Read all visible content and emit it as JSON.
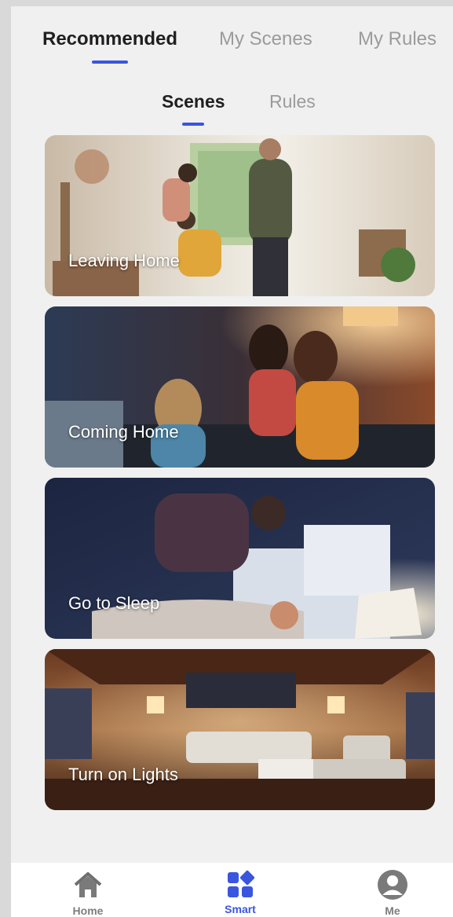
{
  "top_tabs": [
    {
      "label": "Recommended",
      "active": true
    },
    {
      "label": "My Scenes",
      "active": false
    },
    {
      "label": "My Rules",
      "active": false
    }
  ],
  "sub_tabs": [
    {
      "label": "Scenes",
      "active": true
    },
    {
      "label": "Rules",
      "active": false
    }
  ],
  "scenes": [
    {
      "label": "Leaving Home"
    },
    {
      "label": "Coming Home"
    },
    {
      "label": "Go to Sleep"
    },
    {
      "label": "Turn on Lights"
    }
  ],
  "bottom_nav": [
    {
      "label": "Home",
      "icon": "home-icon",
      "active": false
    },
    {
      "label": "Smart",
      "icon": "smart-icon",
      "active": true
    },
    {
      "label": "Me",
      "icon": "user-icon",
      "active": false
    }
  ],
  "colors": {
    "accent": "#3a55e0",
    "background": "#f0f0f0",
    "inactive_text": "#9b9b9b"
  }
}
